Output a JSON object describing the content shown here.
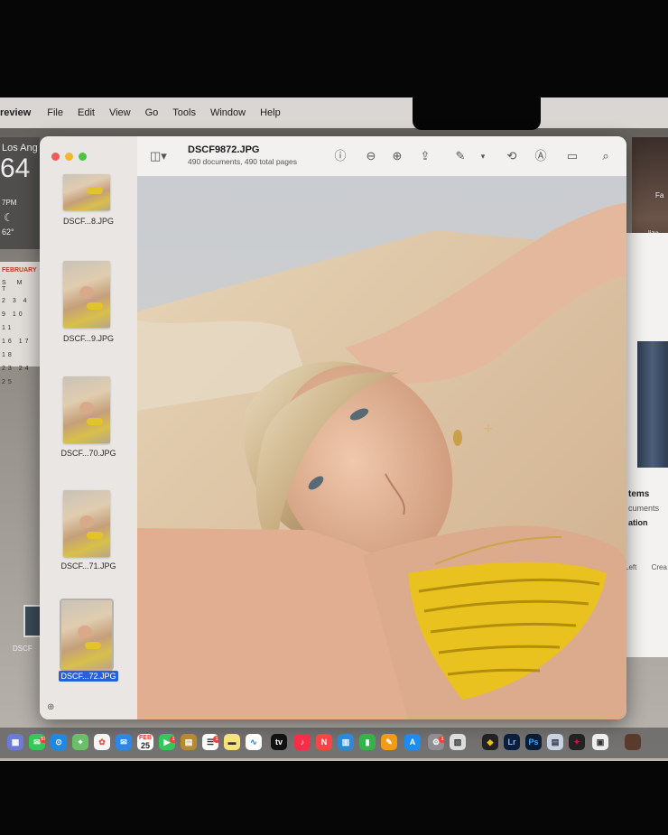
{
  "menubar": {
    "app_name": "review",
    "items": [
      "File",
      "Edit",
      "View",
      "Go",
      "Tools",
      "Window",
      "Help"
    ]
  },
  "widgets": {
    "weather": {
      "city": "Los Ang",
      "temp": "64",
      "time": "7PM",
      "low": "62°"
    },
    "calendar": {
      "month": "FEBRUARY",
      "dows": "S M T",
      "rows": [
        "2 3 4",
        "9 10 11",
        "16 17 18",
        "23 24 25"
      ]
    }
  },
  "desktop": {
    "file_label": "DSCF"
  },
  "right_windows": {
    "photo_tag": "liza",
    "photo_corner": "Fa",
    "items_label": "tems",
    "documents_label": "cuments",
    "location_label": "ation",
    "footer_labels": "Left Crea"
  },
  "preview": {
    "title": "DSCF9872.JPG",
    "subtitle": "490 documents, 490 total pages",
    "toolbar_icons": [
      "sidebar-toggle-icon",
      "info-icon",
      "zoom-out-icon",
      "zoom-in-icon",
      "share-icon",
      "markup-pen-icon",
      "rotate-icon",
      "annotate-icon",
      "highlight-icon",
      "search-icon"
    ],
    "thumbnails": [
      {
        "label": "DSCF...8.JPG",
        "selected": false
      },
      {
        "label": "DSCF...9.JPG",
        "selected": false
      },
      {
        "label": "DSCF...70.JPG",
        "selected": false
      },
      {
        "label": "DSCF...71.JPG",
        "selected": false
      },
      {
        "label": "DSCF...72.JPG",
        "selected": true
      }
    ],
    "sidebar_footer_icon": "add-icon"
  },
  "dock": {
    "apps": [
      "Launchpad",
      "Messages",
      "Safari",
      "Maps",
      "Photos",
      "Mail",
      "Calendar",
      "FaceTime",
      "Notes",
      "Reminders",
      "Freeform",
      "TV",
      "Music",
      "News",
      "Keynote",
      "Numbers",
      "Pages",
      "App Store",
      "Settings",
      "Notes2",
      "Finder2",
      "Lr",
      "Ps",
      "Preview",
      "Resolve",
      "Photos2",
      "Trash"
    ],
    "calendar_day": "25",
    "calendar_month": "FEB",
    "tv_label": "tv",
    "lr_label": "Lr",
    "ps_label": "Ps",
    "messages_badge": "57",
    "facetime_badge": "1",
    "reminders_badge": "1",
    "settings_badge": "1"
  }
}
